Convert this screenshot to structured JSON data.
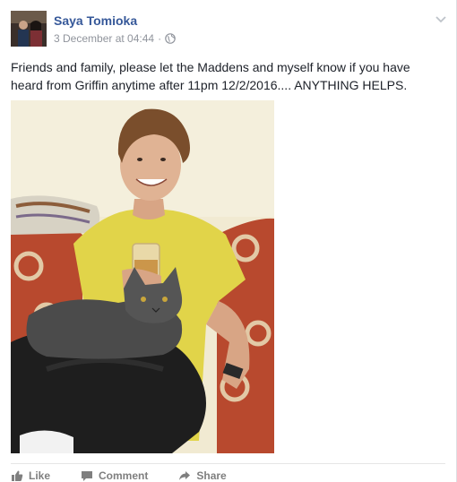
{
  "post": {
    "author": "Saya Tomioka",
    "timestamp": "3 December at 04:44",
    "separator": "·",
    "audience_icon": "globe-icon",
    "menu_icon": "chevron-down-icon",
    "message": "Friends and family, please let the Maddens and myself know if you have heard from Griffin anytime after 11pm 12/2/2016.... ANYTHING HELPS."
  },
  "actions": {
    "like_label": "Like",
    "comment_label": "Comment",
    "share_label": "Share"
  },
  "colors": {
    "author_link": "#365899",
    "meta_text": "#90949c",
    "action_text": "#7f7f7f"
  }
}
